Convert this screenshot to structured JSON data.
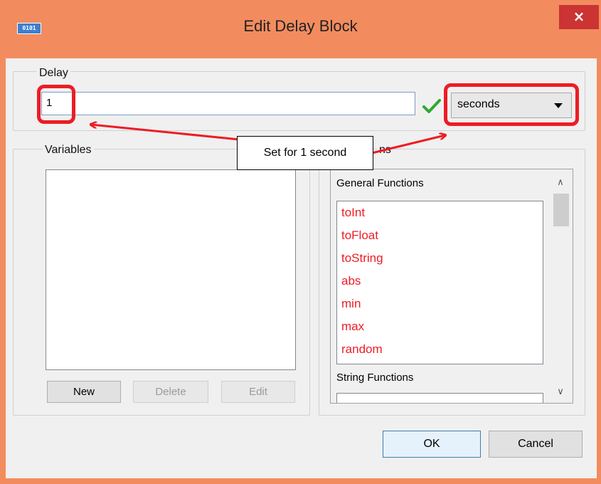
{
  "window": {
    "title": "Edit Delay Block",
    "icon_text": "0101",
    "close_glyph": "×"
  },
  "delay": {
    "group_label": "Delay",
    "value": "1",
    "unit_selected": "seconds"
  },
  "variables": {
    "group_label": "Variables",
    "items": [],
    "buttons": {
      "new": "New",
      "delete": "Delete",
      "edit": "Edit"
    }
  },
  "functions": {
    "group_label_visible": "ns",
    "sections": [
      {
        "header": "General Functions",
        "items": [
          "toInt",
          "toFloat",
          "toString",
          "abs",
          "min",
          "max",
          "random"
        ]
      },
      {
        "header": "String Functions",
        "items": []
      }
    ]
  },
  "dialog_buttons": {
    "ok": "OK",
    "cancel": "Cancel"
  },
  "annotation": {
    "callout_text": "Set for 1 second",
    "color": "#ee1c24"
  },
  "colors": {
    "title_bar": "#f28c5e",
    "function_item": "#ee1c24",
    "valid_check": "#2eaa2e"
  }
}
